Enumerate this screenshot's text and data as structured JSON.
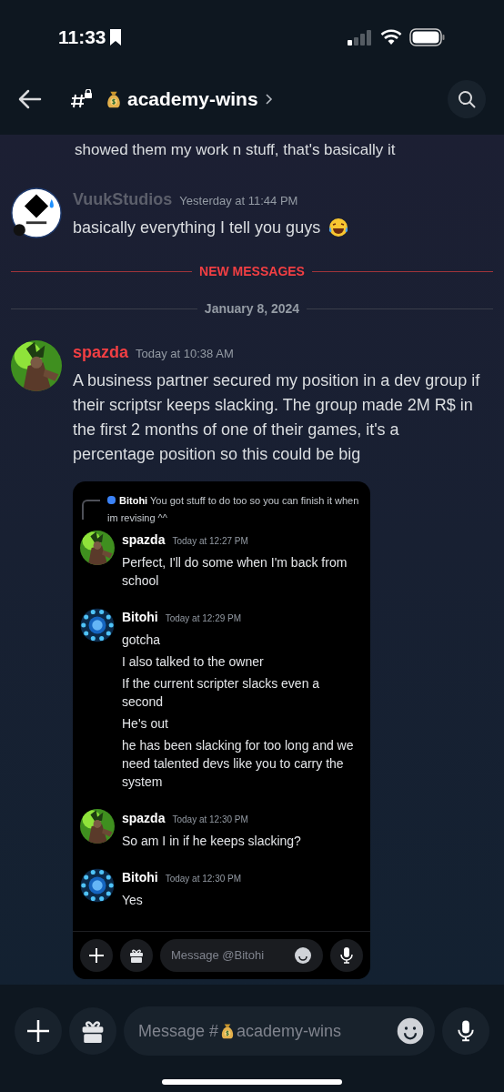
{
  "status_bar": {
    "time": "11:33"
  },
  "header": {
    "channel": "academy-wins"
  },
  "partial_line": "showed them my work n stuff, that's basically it",
  "messages": [
    {
      "author": "VuukStudios",
      "time": "Yesterday at 11:44 PM",
      "text": "basically everything I tell you guys",
      "laughing_emoji": true,
      "color": "#5c5f6b"
    }
  ],
  "divider_new": "NEW MESSAGES",
  "date_divider": "January 8, 2024",
  "main_message": {
    "author": "spazda",
    "time": "Today at 10:38 AM",
    "text": "A business partner secured my position in a dev group if their scriptsr keeps slacking. The group made 2M R$ in the first 2 months of one of their games, it's a percentage position so this could be big",
    "color": "#f23f43"
  },
  "screenshot": {
    "reply": {
      "author": "Bitohi",
      "text": "You got stuff to do too so you can finish it when im revising ^^"
    },
    "messages": [
      {
        "author": "spazda",
        "time": "Today at 12:27 PM",
        "lines": [
          "Perfect, I'll do some when I'm back from school"
        ]
      },
      {
        "author": "Bitohi",
        "time": "Today at 12:29 PM",
        "lines": [
          "gotcha",
          "I also talked to the owner",
          "If the current scripter slacks even a second",
          "He's out",
          "he has been slacking for too long and we need talented devs like you to carry the system"
        ]
      },
      {
        "author": "spazda",
        "time": "Today at 12:30 PM",
        "lines": [
          "So am I in if he keeps slacking?"
        ]
      },
      {
        "author": "Bitohi",
        "time": "Today at 12:30 PM",
        "lines": [
          "Yes"
        ]
      }
    ],
    "input": {
      "placeholder": "Message @Bitohi"
    }
  },
  "composer": {
    "placeholder_before": "Message #",
    "placeholder_channel": "academy-wins"
  }
}
